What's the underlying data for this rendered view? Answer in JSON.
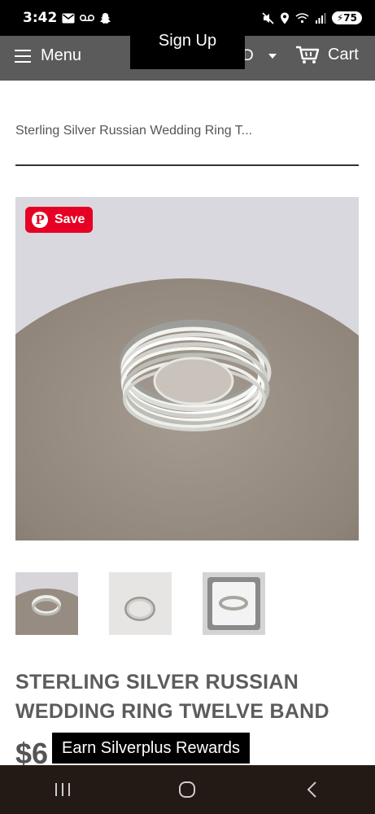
{
  "status_bar": {
    "time": "3:42",
    "battery": "75",
    "left_icons": [
      "gmail-icon",
      "voicemail-icon",
      "snapchat-icon"
    ],
    "right_icons": [
      "mute-icon",
      "location-icon",
      "wifi-icon",
      "signal-icon"
    ]
  },
  "header": {
    "menu_label": "Menu",
    "currency": "D",
    "cart_label": "Cart",
    "signup_label": "Sign Up",
    "background_color": "#5b5b5b"
  },
  "breadcrumb": "Sterling Silver Russian Wedding Ring T...",
  "pinterest": {
    "save_label": "Save",
    "color": "#e60023"
  },
  "product": {
    "title": "STERLING SILVER RUSSIAN WEDDING RING TWELVE BAND",
    "price_partial": "$6"
  },
  "rewards_label": "Earn Silverplus Rewards",
  "nav": [
    "recents-icon",
    "home-icon",
    "back-icon"
  ]
}
